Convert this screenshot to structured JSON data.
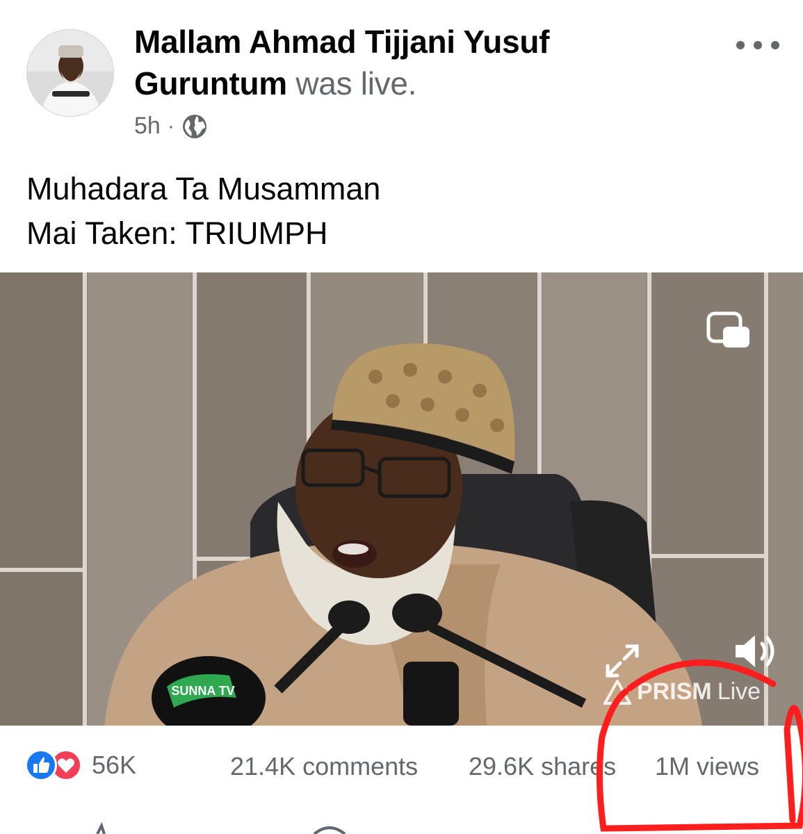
{
  "post": {
    "author_name": "Mallam Ahmad Tijjani Yusuf Guruntum",
    "action_text": "was live.",
    "time": "5h",
    "separator": "·",
    "privacy_icon": "globe-icon",
    "more_icon": "more-options-icon",
    "caption_line1": "Muhadara Ta Musamman",
    "caption_line2": "Mai Taken: TRIUMPH"
  },
  "video": {
    "pip_icon": "picture-in-picture-icon",
    "expand_icon": "expand-icon",
    "sound_icon": "speaker-icon",
    "watermark_brand": "PRISM",
    "watermark_live": "Live",
    "mic_logo_text": "SUNNA TV"
  },
  "stats": {
    "reaction_count": "56K",
    "comments": "21.4K comments",
    "shares": "29.6K shares",
    "views": "1M views"
  },
  "colors": {
    "like_blue": "#1877f2",
    "love_red": "#f33e58",
    "annotation_red": "#ff1e1e",
    "secondary_text": "#65676b"
  }
}
